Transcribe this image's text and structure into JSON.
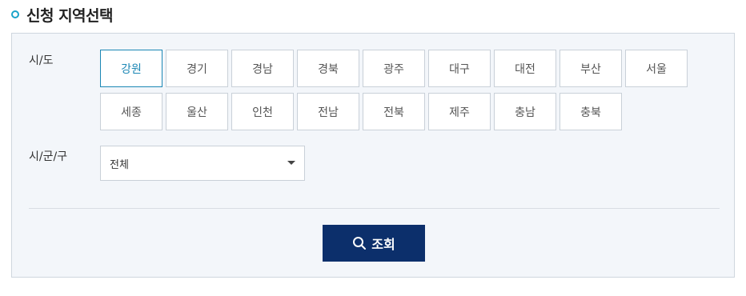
{
  "section": {
    "title": "신청 지역선택"
  },
  "sido": {
    "label": "시/도",
    "selected": "강원",
    "regions": [
      "강원",
      "경기",
      "경남",
      "경북",
      "광주",
      "대구",
      "대전",
      "부산",
      "서울",
      "세종",
      "울산",
      "인천",
      "전남",
      "전북",
      "제주",
      "충남",
      "충북"
    ]
  },
  "sigungu": {
    "label": "시/군/구",
    "value": "전체"
  },
  "search": {
    "label": "조회"
  },
  "colors": {
    "accent": "#1c87b5",
    "bullet": "#1aa3c9",
    "button_bg": "#0c2f6b",
    "panel_bg": "#f3f6fa"
  },
  "icons": {
    "bullet": "circle-bullet-icon",
    "caret": "caret-down-icon",
    "search": "search-icon"
  }
}
